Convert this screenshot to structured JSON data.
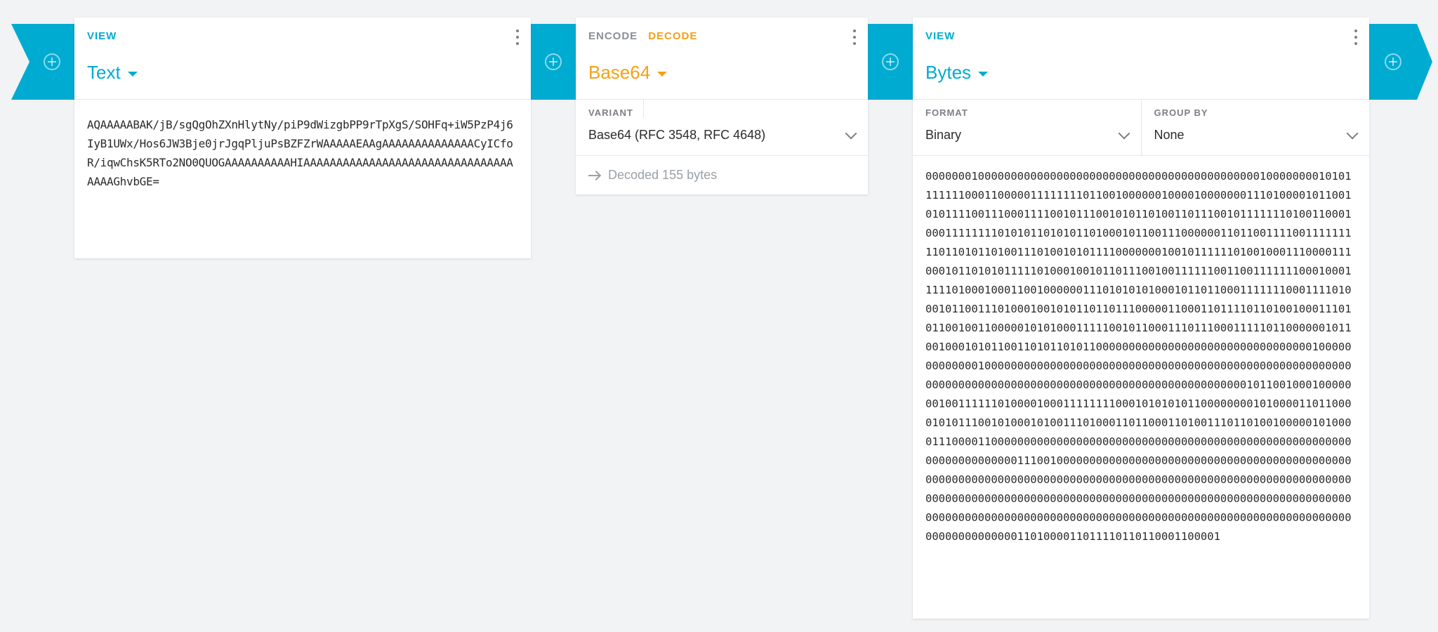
{
  "step1": {
    "tab": "VIEW",
    "title": "Text",
    "content": "AQAAAAABAK/jB/sgQgOhZXnHlytNy/piP9dWizgbPP9rTpXgS/SOHFq+iW5PzP4j6IyB1UWx/Hos6JW3Bje0jrJgqPljuPsBZFZrWAAAAAEAAgAAAAAAAAAAAAAACyICfoR/iqwChsK5RTo2NO0QUOGAAAAAAAAAAHIAAAAAAAAAAAAAAAAAAAAAAAAAAAAAAAAAAAAGhvbGE="
  },
  "step2": {
    "tabs": [
      "ENCODE",
      "DECODE"
    ],
    "title": "Base64",
    "variant_label": "VARIANT",
    "variant_value": "Base64 (RFC 3548, RFC 4648)",
    "status": "Decoded 155 bytes"
  },
  "step3": {
    "tab": "VIEW",
    "title": "Bytes",
    "format_label": "FORMAT",
    "format_value": "Binary",
    "group_label": "GROUP BY",
    "group_value": "None",
    "content": "00000001000000000000000000000000000000000000000000010000000010101111111000110000011111111011001000000100001000000011101000010110010101111001110001111001011100101011010011011100101111111010011000100011111111010101101010110100010110011100000011011001111001111111110110101101001110100101011110000000100101111110100100011100001110001011010101111101000100101101110010011111100110011111110001000111110100010001100100000011101010101000101101100011111110001111010001011001110100010010101101101110000011000110111101101001000111010110010011000001010100011111001011000111011100011111011000000101100100010101100110101101011000000000000000000000000000000000100000000000001000000000000000000000000000000000000000000000000000000000000000000000000000000000000000000000000000000000101100100010000000100111111010000100011111111000101010101100000000101000011011000010101110010100010100111010001101100011010011101101001000001010000111000011000000000000000000000000000000000000000000000000000000000000000000000111001000000000000000000000000000000000000000000000000000000000000000000000000000000000000000000000000000000000000000000000000000000000000000000000000000000000000000000000000000000000000000000000000000000000000000000000000000000000000000000000000000000000000001101000011011110110110001100001"
  }
}
